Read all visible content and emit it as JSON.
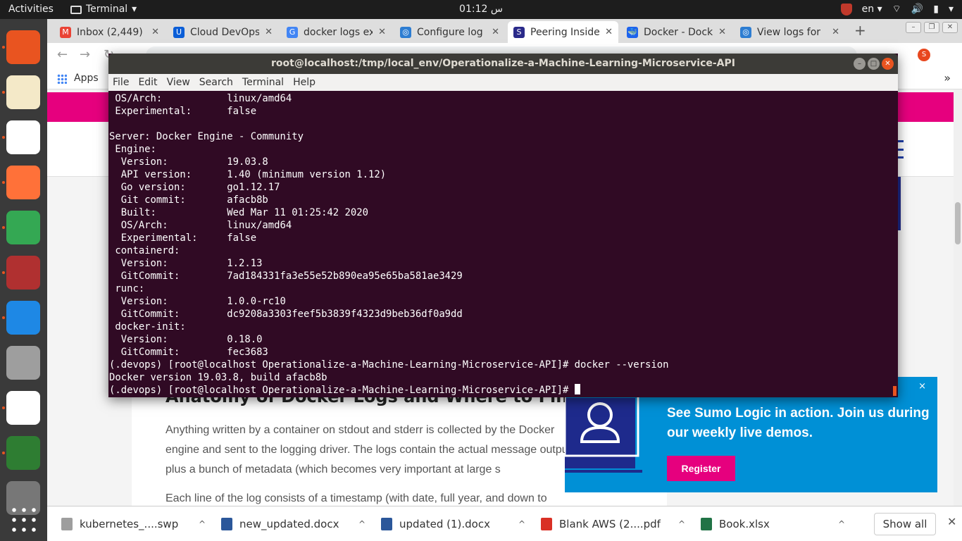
{
  "topbar": {
    "activities": "Activities",
    "app_name": "Terminal",
    "clock": "01:12 س",
    "lang": "en"
  },
  "browser": {
    "tabs": [
      {
        "title": "Inbox (2,449) -",
        "fav_color": "#ea4335",
        "fav_glyph": "M"
      },
      {
        "title": "Cloud DevOps",
        "fav_color": "#0b5ed7",
        "fav_glyph": "U"
      },
      {
        "title": "docker logs ex",
        "fav_color": "#4285f4",
        "fav_glyph": "G"
      },
      {
        "title": "Configure log",
        "fav_color": "#2d7dd2",
        "fav_glyph": "◎"
      },
      {
        "title": "Peering Inside",
        "fav_color": "#2a2a8a",
        "fav_glyph": "S"
      },
      {
        "title": "Docker - Dock",
        "fav_color": "#1d63ed",
        "fav_glyph": "🐳"
      },
      {
        "title": "View logs for",
        "fav_color": "#2d7dd2",
        "fav_glyph": "◎"
      }
    ],
    "active_tab": 4,
    "bookmarks": {
      "apps_label": "Apps"
    },
    "profile_letter": "S"
  },
  "page": {
    "heading": "Anatomy of Docker Logs and Where to Find Them",
    "paragraph1": "Anything written by a container on stdout and stderr is collected by the Docker engine and sent to the logging driver. The logs contain the actual message output plus a bunch of metadata (which becomes very important at large s",
    "paragraph2": "Each line of the log consists of a timestamp (with date, full year, and down to",
    "promo": {
      "text": "See Sumo Logic in action. Join us during our weekly live demos.",
      "button": "Register",
      "close": "×"
    }
  },
  "downloads": {
    "items": [
      {
        "name": "kubernetes_....swp",
        "color": "#9e9e9e"
      },
      {
        "name": "new_updated.docx",
        "color": "#2b579a"
      },
      {
        "name": "updated (1).docx",
        "color": "#2b579a"
      },
      {
        "name": "Blank AWS (2....pdf",
        "color": "#d93025"
      },
      {
        "name": "Book.xlsx",
        "color": "#217346"
      }
    ],
    "show_all": "Show all"
  },
  "terminal": {
    "title": "root@localhost:/tmp/local_env/Operationalize-a-Machine-Learning-Microservice-API",
    "menu": [
      "File",
      "Edit",
      "View",
      "Search",
      "Terminal",
      "Help"
    ],
    "lines": [
      " OS/Arch:           linux/amd64",
      " Experimental:      false",
      "",
      "Server: Docker Engine - Community",
      " Engine:",
      "  Version:          19.03.8",
      "  API version:      1.40 (minimum version 1.12)",
      "  Go version:       go1.12.17",
      "  Git commit:       afacb8b",
      "  Built:            Wed Mar 11 01:25:42 2020",
      "  OS/Arch:          linux/amd64",
      "  Experimental:     false",
      " containerd:",
      "  Version:          1.2.13",
      "  GitCommit:        7ad184331fa3e55e52b890ea95e65ba581ae3429",
      " runc:",
      "  Version:          1.0.0-rc10",
      "  GitCommit:        dc9208a3303feef5b3839f4323d9beb36df0a9dd",
      " docker-init:",
      "  Version:          0.18.0",
      "  GitCommit:        fec3683",
      "(.devops) [root@localhost Operationalize-a-Machine-Learning-Microservice-API]# docker --version",
      "Docker version 19.03.8, build afacb8b"
    ],
    "prompt": "(.devops) [root@localhost Operationalize-a-Machine-Learning-Microservice-API]# "
  },
  "dock": {
    "apps": [
      {
        "name": "remote-desktop-icon",
        "color": "#e95420"
      },
      {
        "name": "text-editor-icon",
        "color": "#f4e9c8"
      },
      {
        "name": "pdf-reader-icon",
        "color": "#ffffff"
      },
      {
        "name": "firefox-icon",
        "color": "#ff7139"
      },
      {
        "name": "chrome-icon",
        "color": "#34a853"
      },
      {
        "name": "settings-tools-icon",
        "color": "#b03030"
      },
      {
        "name": "vscode-icon",
        "color": "#1e88e5"
      },
      {
        "name": "camera-icon",
        "color": "#9e9e9e"
      },
      {
        "name": "writer-doc-icon",
        "color": "#ffffff"
      },
      {
        "name": "calc-sheet-icon",
        "color": "#2e7d32"
      },
      {
        "name": "drive-icon",
        "color": "#777777"
      }
    ]
  }
}
